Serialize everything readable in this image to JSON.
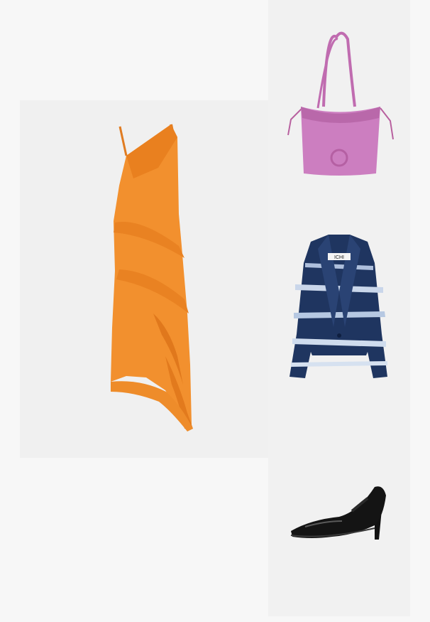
{
  "products": [
    {
      "id": "dress",
      "item_icon": "orange-asymmetric-ruffle-dress-image",
      "color": "#f08a2a",
      "background": "#f0f0f0"
    },
    {
      "id": "bag",
      "item_icon": "pink-suede-drawstring-bag-image",
      "color": "#c870b8",
      "background": "#f1f1f1"
    },
    {
      "id": "blazer",
      "item_icon": "navy-tie-dye-blazer-image",
      "color": "#1f3560",
      "background": "#f1f1f1",
      "label_text": "ICHI"
    },
    {
      "id": "shoe",
      "item_icon": "black-patent-pump-image",
      "color": "#111111",
      "background": "#f1f1f1"
    }
  ]
}
